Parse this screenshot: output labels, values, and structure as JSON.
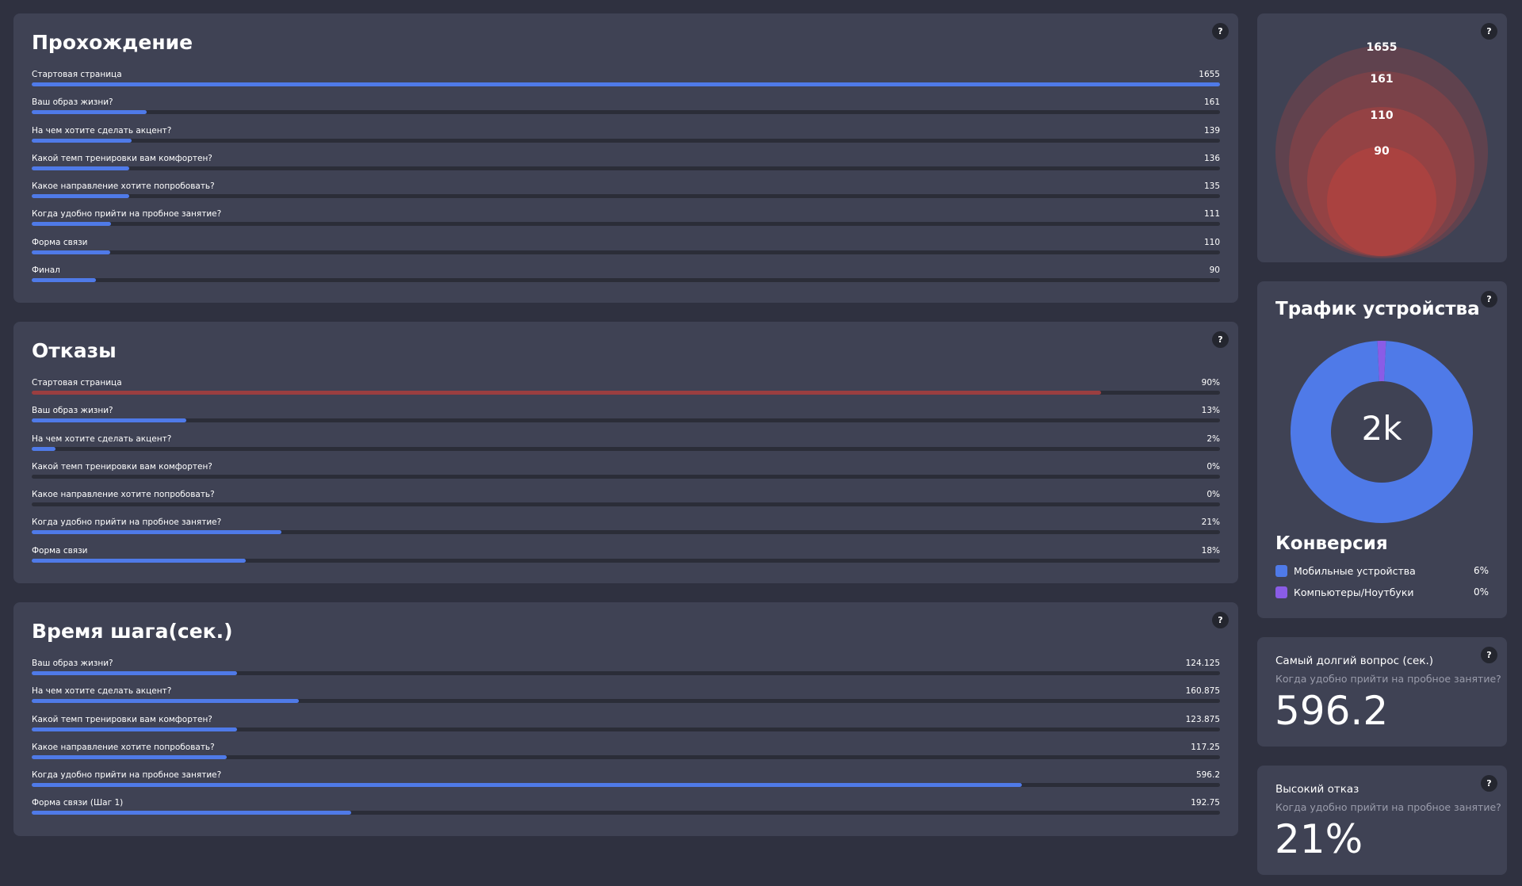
{
  "colors": {
    "accent_blue": "#4f7ae8",
    "accent_red": "#9a3e40",
    "purple": "#8a5ce6",
    "card_bg": "#3f4254",
    "page_bg": "#2f3140"
  },
  "help_label": "?",
  "passage": {
    "title": "Прохождение",
    "max": 1655,
    "rows": [
      {
        "label": "Стартовая страница",
        "value": "1655",
        "fill": 1.0
      },
      {
        "label": "Ваш образ жизни?",
        "value": "161",
        "fill": 0.097
      },
      {
        "label": "На чем хотите сделать акцент?",
        "value": "139",
        "fill": 0.084
      },
      {
        "label": "Какой темп тренировки вам комфортен?",
        "value": "136",
        "fill": 0.082
      },
      {
        "label": "Какое направление хотите попробовать?",
        "value": "135",
        "fill": 0.082
      },
      {
        "label": "Когда удобно прийти на пробное занятие?",
        "value": "111",
        "fill": 0.067
      },
      {
        "label": "Форма связи",
        "value": "110",
        "fill": 0.066
      },
      {
        "label": "Финал",
        "value": "90",
        "fill": 0.054
      }
    ]
  },
  "bounces": {
    "title": "Отказы",
    "rows": [
      {
        "label": "Стартовая страница",
        "value": "90%",
        "fill": 0.9,
        "color": "red"
      },
      {
        "label": "Ваш образ жизни?",
        "value": "13%",
        "fill": 0.13
      },
      {
        "label": "На чем хотите сделать акцент?",
        "value": "2%",
        "fill": 0.02
      },
      {
        "label": "Какой темп тренировки вам комфортен?",
        "value": "0%",
        "fill": 0
      },
      {
        "label": "Какое направление хотите попробовать?",
        "value": "0%",
        "fill": 0
      },
      {
        "label": "Когда удобно прийти на пробное занятие?",
        "value": "21%",
        "fill": 0.21
      },
      {
        "label": "Форма связи",
        "value": "18%",
        "fill": 0.18
      }
    ]
  },
  "step_time": {
    "title": "Время шага(сек.)",
    "rows": [
      {
        "label": "Ваш образ жизни?",
        "value": "124.125",
        "fill": 0.173
      },
      {
        "label": "На чем хотите сделать акцент?",
        "value": "160.875",
        "fill": 0.225
      },
      {
        "label": "Какой темп тренировки вам комфортен?",
        "value": "123.875",
        "fill": 0.173
      },
      {
        "label": "Какое направление хотите попробовать?",
        "value": "117.25",
        "fill": 0.164
      },
      {
        "label": "Когда удобно прийти на пробное занятие?",
        "value": "596.2",
        "fill": 0.833
      },
      {
        "label": "Форма связи (Шаг 1)",
        "value": "192.75",
        "fill": 0.269
      }
    ]
  },
  "funnel": {
    "labels": [
      "1655",
      "161",
      "110",
      "90"
    ]
  },
  "traffic": {
    "title": "Трафик устройства",
    "center_label": "2k",
    "shares": [
      {
        "name": "Мобильные устройства",
        "share": 0.985,
        "color": "#4f7ae8"
      },
      {
        "name": "Компьютеры/Ноутбуки",
        "share": 0.015,
        "color": "#8a5ce6"
      }
    ]
  },
  "conversion": {
    "title": "Конверсия",
    "items": [
      {
        "label": "Мобильные устройства",
        "value": "6%",
        "color": "#4f7ae8"
      },
      {
        "label": "Компьютеры/Ноутбуки",
        "value": "0%",
        "color": "#8a5ce6"
      }
    ]
  },
  "longest_question": {
    "label": "Самый долгий вопрос (сек.)",
    "question": "Когда удобно прийти на пробное занятие?",
    "value": "596.2"
  },
  "high_bounce": {
    "label": "Высокий отказ",
    "question": "Когда удобно прийти на пробное занятие?",
    "value": "21%"
  }
}
